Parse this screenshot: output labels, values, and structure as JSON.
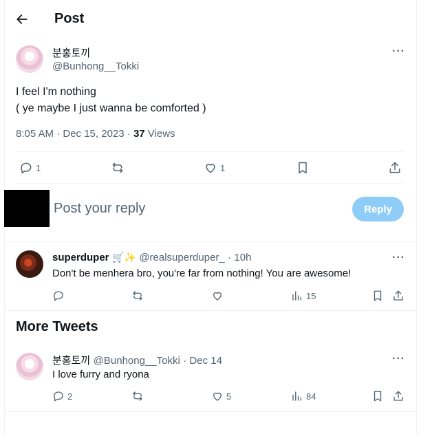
{
  "header": {
    "title": "Post"
  },
  "main_post": {
    "display_name": "분홍토끼",
    "handle": "@Bunhong__Tokki",
    "text_line1": "I feel I'm nothing",
    "text_line2": "( ye maybe I just wanna be comforted )",
    "time_date": "8:05 AM · Dec 15, 2023 · ",
    "views_count": "37",
    "views_label": " Views",
    "replies": "1",
    "likes": "1"
  },
  "reply_composer": {
    "placeholder": "Post your reply",
    "button_label": "Reply"
  },
  "replies": [
    {
      "display_name": "superduper",
      "emojis": "🛒✨",
      "handle": "@realsuperduper_",
      "time": "· 10h",
      "text": "Don't be menhera bro, you're far from nothing!  You are awesome!",
      "views": "15"
    }
  ],
  "more_tweets": {
    "title": "More Tweets",
    "items": [
      {
        "display_name": "분홍토끼",
        "handle": "@Bunhong__Tokki",
        "time": "· Dec 14",
        "text": "I love furry and ryona",
        "replies": "2",
        "likes": "5",
        "views": "84"
      }
    ]
  },
  "icons": [
    "back-arrow-icon",
    "more-icon",
    "reply-icon",
    "retweet-icon",
    "like-icon",
    "bookmark-icon",
    "share-icon",
    "views-icon"
  ],
  "colors": {
    "accent": "#1d9bf0",
    "reply_button": "#8ecdf7",
    "muted": "#536471",
    "divider": "#eff3f4"
  }
}
